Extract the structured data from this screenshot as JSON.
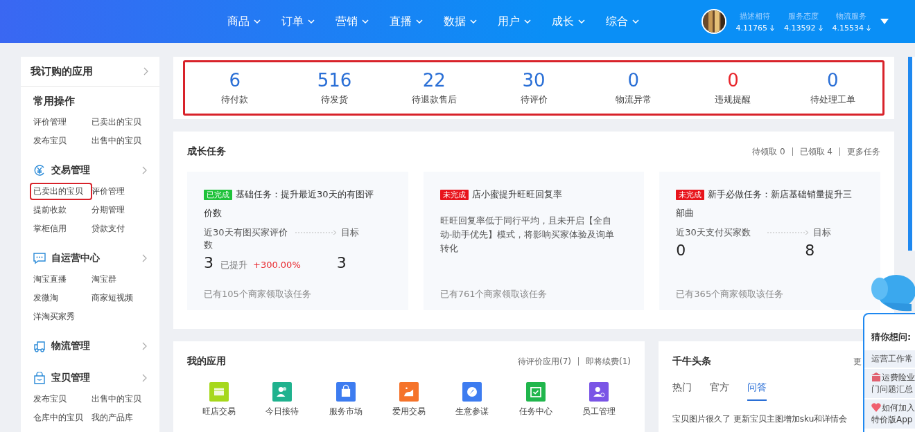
{
  "header": {
    "nav": [
      {
        "label": "商品"
      },
      {
        "label": "订单"
      },
      {
        "label": "营销"
      },
      {
        "label": "直播"
      },
      {
        "label": "数据"
      },
      {
        "label": "用户"
      },
      {
        "label": "成长"
      },
      {
        "label": "综合"
      }
    ],
    "ratings": [
      {
        "label": "描述相符",
        "value": "4.11765"
      },
      {
        "label": "服务态度",
        "value": "4.13592"
      },
      {
        "label": "物流服务",
        "value": "4.15534"
      }
    ]
  },
  "sidebar": {
    "title": "我订购的应用",
    "sections": [
      {
        "title": "常用操作",
        "expandable": false,
        "items": [
          {
            "label": "评价管理",
            "highlighted": false
          },
          {
            "label": "已卖出的宝贝",
            "highlighted": false
          },
          {
            "label": "发布宝贝",
            "highlighted": false
          },
          {
            "label": "出售中的宝贝",
            "highlighted": false
          }
        ]
      },
      {
        "title": "交易管理",
        "expandable": true,
        "items": [
          {
            "label": "已卖出的宝贝",
            "highlighted": true
          },
          {
            "label": "评价管理",
            "highlighted": false
          },
          {
            "label": "提前收款",
            "highlighted": false
          },
          {
            "label": "分期管理",
            "highlighted": false
          },
          {
            "label": "掌柜信用",
            "highlighted": false
          },
          {
            "label": "贷款支付",
            "highlighted": false
          }
        ]
      },
      {
        "title": "自运营中心",
        "expandable": true,
        "items": [
          {
            "label": "淘宝直播",
            "highlighted": false
          },
          {
            "label": "淘宝群",
            "highlighted": false
          },
          {
            "label": "发微淘",
            "highlighted": false
          },
          {
            "label": "商家短视频",
            "highlighted": false
          },
          {
            "label": "洋淘买家秀",
            "highlighted": false
          }
        ]
      },
      {
        "title": "物流管理",
        "expandable": true
      },
      {
        "title": "宝贝管理",
        "expandable": true,
        "items": [
          {
            "label": "发布宝贝",
            "highlighted": false
          },
          {
            "label": "出售中的宝贝",
            "highlighted": false
          },
          {
            "label": "仓库中的宝贝",
            "highlighted": false
          },
          {
            "label": "我的产品库",
            "highlighted": false
          }
        ]
      }
    ]
  },
  "stats": {
    "highlighted": true,
    "items": [
      {
        "value": "6",
        "label": "待付款",
        "color": "#2a6fd6"
      },
      {
        "value": "516",
        "label": "待发货",
        "color": "#2a6fd6"
      },
      {
        "value": "22",
        "label": "待退款售后",
        "color": "#2a6fd6"
      },
      {
        "value": "30",
        "label": "待评价",
        "color": "#2a6fd6"
      },
      {
        "value": "0",
        "label": "物流异常",
        "color": "#2a6fd6"
      },
      {
        "value": "0",
        "label": "违规提醒",
        "color": "#e8252b"
      },
      {
        "value": "0",
        "label": "待处理工单",
        "color": "#2a6fd6"
      }
    ]
  },
  "growth_tasks": {
    "title": "成长任务",
    "links": [
      "待领取 0",
      "已领取 4",
      "更多任务"
    ],
    "tasks": [
      {
        "status": "已完成",
        "done": true,
        "title": "基础任务：提升最近30天的有图评价数",
        "kind": "metric",
        "metric_label": "近30天有图买家评价数",
        "target_label": "目标",
        "current": "3",
        "improve_label": "已提升",
        "improve": "+300.00%",
        "target": "3",
        "footer": "已有105个商家领取该任务"
      },
      {
        "status": "未完成",
        "done": false,
        "title": "店小蜜提升旺旺回复率",
        "kind": "description",
        "description": "旺旺回复率低于同行平均，且未开启【全自动-助手优先】模式，将影响买家体验及询单转化",
        "footer": "已有761个商家领取该任务"
      },
      {
        "status": "未完成",
        "done": false,
        "title": "新手必做任务：新店基础销量提升三部曲",
        "kind": "metric",
        "metric_label": "近30天支付买家数",
        "target_label": "目标",
        "current": "0",
        "target": "8",
        "footer": "已有365个商家领取该任务"
      }
    ]
  },
  "my_apps": {
    "title": "我的应用",
    "links": [
      "待评价应用(7)",
      "即将续费(1)"
    ],
    "apps": [
      {
        "label": "旺店交易",
        "color": "#a6d81c"
      },
      {
        "label": "今日接待",
        "color": "#1fb28e"
      },
      {
        "label": "服务市场",
        "color": "#3d7cf0"
      },
      {
        "label": "爱用交易",
        "color": "#f5732a"
      },
      {
        "label": "生意参谋",
        "color": "#3d7cf0"
      },
      {
        "label": "任务中心",
        "color": "#20b64c"
      },
      {
        "label": "员工管理",
        "color": "#7a55e6"
      }
    ]
  },
  "headlines": {
    "title": "千牛头条",
    "more": "更",
    "tabs": [
      {
        "label": "热门",
        "selected": false
      },
      {
        "label": "官方",
        "selected": false
      },
      {
        "label": "问答",
        "selected": true
      }
    ],
    "article": "宝贝图片很久了 更新宝贝主图增加sku和详情会"
  },
  "assistant": {
    "title": "猜你想问:",
    "items": [
      {
        "text": "运营工作常",
        "kind": "plain"
      },
      {
        "text": "运费险业门问题汇总",
        "kind": "building"
      },
      {
        "text": "如何加入特价版App",
        "kind": "heart"
      }
    ]
  }
}
